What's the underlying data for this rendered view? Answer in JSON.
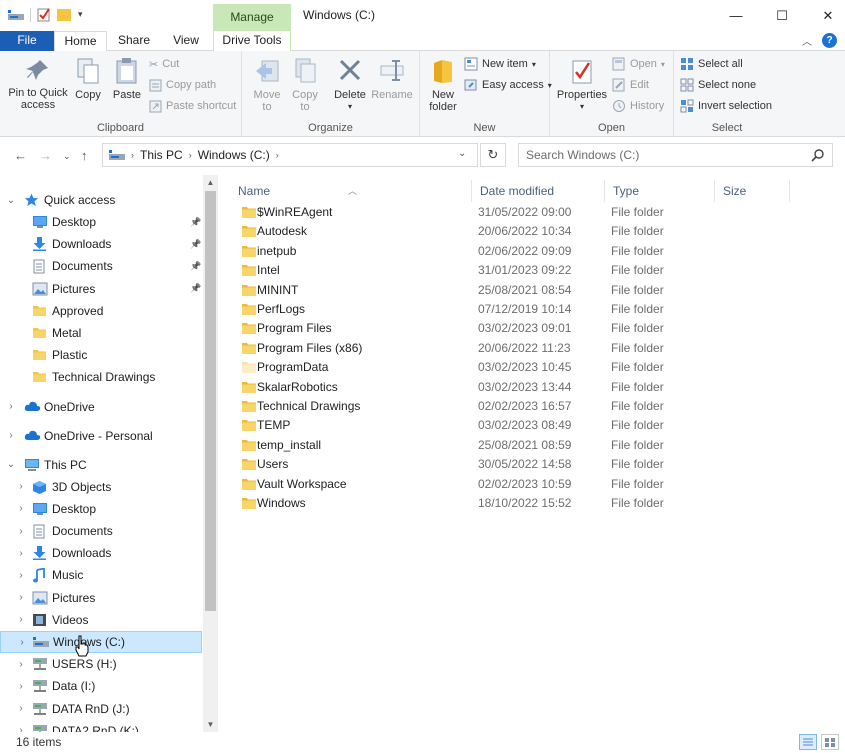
{
  "window": {
    "title": "Windows (C:)",
    "context_tab": "Manage",
    "controls": [
      "—",
      "☐",
      "✕"
    ]
  },
  "tabs": {
    "file": "File",
    "home": "Home",
    "share": "Share",
    "view": "View",
    "drive_tools": "Drive Tools"
  },
  "ribbon": {
    "clipboard": {
      "label": "Clipboard",
      "pin": "Pin to Quick\naccess",
      "copy": "Copy",
      "paste": "Paste",
      "cut": "Cut",
      "copy_path": "Copy path",
      "paste_shortcut": "Paste shortcut"
    },
    "organize": {
      "label": "Organize",
      "move_to": "Move\nto",
      "copy_to": "Copy\nto",
      "delete": "Delete",
      "rename": "Rename"
    },
    "new": {
      "label": "New",
      "new_folder": "New\nfolder",
      "new_item": "New item",
      "easy_access": "Easy access"
    },
    "open": {
      "label": "Open",
      "properties": "Properties",
      "open": "Open",
      "edit": "Edit",
      "history": "History"
    },
    "select": {
      "label": "Select",
      "select_all": "Select all",
      "select_none": "Select none",
      "invert": "Invert selection"
    }
  },
  "address": {
    "crumb1": "This PC",
    "crumb2": "Windows (C:)",
    "search_placeholder": "Search Windows (C:)"
  },
  "nav": {
    "quick_access": "Quick access",
    "quick_items": [
      {
        "label": "Desktop",
        "pinned": true
      },
      {
        "label": "Downloads",
        "pinned": true
      },
      {
        "label": "Documents",
        "pinned": true
      },
      {
        "label": "Pictures",
        "pinned": true
      },
      {
        "label": "Approved",
        "pinned": false
      },
      {
        "label": "Metal",
        "pinned": false
      },
      {
        "label": "Plastic",
        "pinned": false
      },
      {
        "label": "Technical Drawings",
        "pinned": false
      }
    ],
    "onedrive": "OneDrive",
    "onedrive_personal": "OneDrive - Personal",
    "this_pc": "This PC",
    "pc_items": [
      {
        "label": "3D Objects",
        "icon": "cube-icon"
      },
      {
        "label": "Desktop",
        "icon": "desktop-icon"
      },
      {
        "label": "Documents",
        "icon": "document-icon"
      },
      {
        "label": "Downloads",
        "icon": "download-icon"
      },
      {
        "label": "Music",
        "icon": "music-icon"
      },
      {
        "label": "Pictures",
        "icon": "pictures-icon"
      },
      {
        "label": "Videos",
        "icon": "video-icon"
      },
      {
        "label": "Windows (C:)",
        "icon": "drive-icon",
        "selected": true
      },
      {
        "label": "USERS (H:)",
        "icon": "network-drive-icon"
      },
      {
        "label": "Data (I:)",
        "icon": "network-drive-icon"
      },
      {
        "label": "DATA RnD (J:)",
        "icon": "network-drive-icon"
      },
      {
        "label": "DATA2 RnD (K:)",
        "icon": "network-drive-icon"
      }
    ]
  },
  "columns": {
    "name": "Name",
    "date": "Date modified",
    "type": "Type",
    "size": "Size"
  },
  "files": [
    {
      "name": "$WinREAgent",
      "date": "31/05/2022 09:00",
      "type": "File folder",
      "faded": false
    },
    {
      "name": "Autodesk",
      "date": "20/06/2022 10:34",
      "type": "File folder",
      "faded": false
    },
    {
      "name": "inetpub",
      "date": "02/06/2022 09:09",
      "type": "File folder",
      "faded": false
    },
    {
      "name": "Intel",
      "date": "31/01/2023 09:22",
      "type": "File folder",
      "faded": false
    },
    {
      "name": "MININT",
      "date": "25/08/2021 08:54",
      "type": "File folder",
      "faded": false
    },
    {
      "name": "PerfLogs",
      "date": "07/12/2019 10:14",
      "type": "File folder",
      "faded": false
    },
    {
      "name": "Program Files",
      "date": "03/02/2023 09:01",
      "type": "File folder",
      "faded": false
    },
    {
      "name": "Program Files (x86)",
      "date": "20/06/2022 11:23",
      "type": "File folder",
      "faded": false
    },
    {
      "name": "ProgramData",
      "date": "03/02/2023 10:45",
      "type": "File folder",
      "faded": true
    },
    {
      "name": "SkalarRobotics",
      "date": "03/02/2023 13:44",
      "type": "File folder",
      "faded": false
    },
    {
      "name": "Technical Drawings",
      "date": "02/02/2023 16:57",
      "type": "File folder",
      "faded": false
    },
    {
      "name": "TEMP",
      "date": "03/02/2023 08:49",
      "type": "File folder",
      "faded": false
    },
    {
      "name": "temp_install",
      "date": "25/08/2021 08:59",
      "type": "File folder",
      "faded": false
    },
    {
      "name": "Users",
      "date": "30/05/2022 14:58",
      "type": "File folder",
      "faded": false
    },
    {
      "name": "Vault Workspace",
      "date": "02/02/2023 10:59",
      "type": "File folder",
      "faded": false
    },
    {
      "name": "Windows",
      "date": "18/10/2022 15:52",
      "type": "File folder",
      "faded": false
    }
  ],
  "status": {
    "count": "16 items"
  },
  "colors": {
    "accent": "#1a5fb4",
    "folder": "#f5c542",
    "manage_tab": "#c9e8b8",
    "selection": "#cce8ff"
  }
}
